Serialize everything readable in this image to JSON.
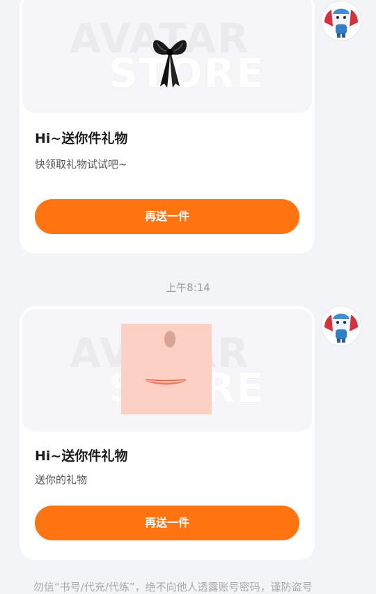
{
  "messages": [
    {
      "watermark_line1": "AVATAR",
      "watermark_line2": "STORE",
      "item_icon": "bow-icon",
      "title": "Hi~送你件礼物",
      "desc": "快领取礼物试试吧~",
      "button_label": "再送一件"
    },
    {
      "watermark_line1": "AVATAR",
      "watermark_line2": "STORE",
      "item_icon": "face-mouth-icon",
      "title": "Hi~送你件礼物",
      "desc": "送你的礼物",
      "button_label": "再送一件"
    }
  ],
  "timestamp": "上午8:14",
  "footer_notice": "勿信“书号/代充/代练”，绝不向他人透露账号密码，谨防盗号",
  "colors": {
    "accent": "#ff7410",
    "background": "#f3f4f8"
  }
}
